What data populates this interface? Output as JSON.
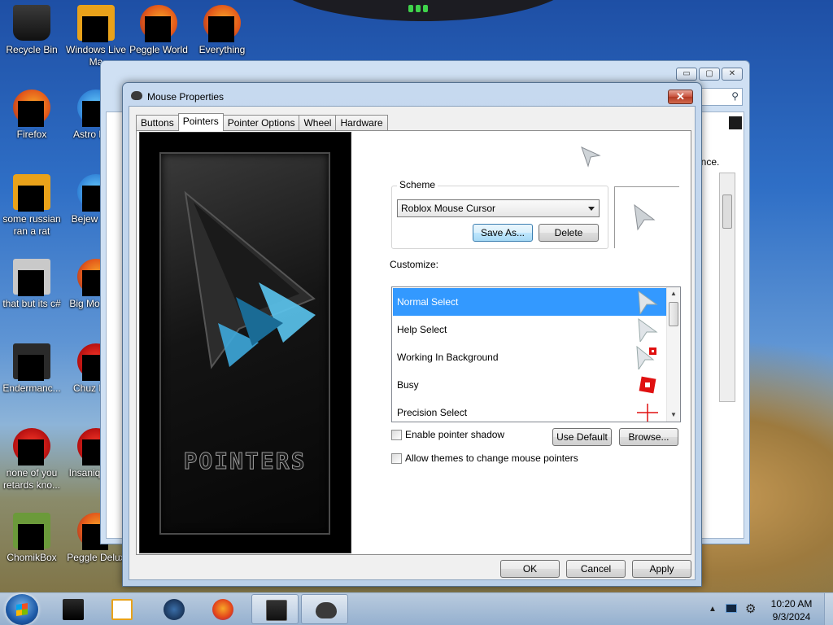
{
  "desktop": {
    "icons": [
      {
        "label": "Recycle Bin"
      },
      {
        "label": "Windows Live Ma"
      },
      {
        "label": "Peggle World"
      },
      {
        "label": "Everything"
      },
      {
        "label": "Firefox"
      },
      {
        "label": "Astro Delu"
      },
      {
        "label": "some russian ran a rat"
      },
      {
        "label": "Bejew Delu"
      },
      {
        "label": "that but its c#"
      },
      {
        "label": "Big Mo Delu"
      },
      {
        "label": "Endermanc..."
      },
      {
        "label": "Chuz Delu"
      },
      {
        "label": "none of you retards kno..."
      },
      {
        "label": "Insaniq Delu"
      },
      {
        "label": "ChomikBox"
      },
      {
        "label": "Peggle Delux"
      }
    ]
  },
  "background_window": {
    "controls": [
      "▭",
      "▢",
      "✕"
    ],
    "partial_text": "ence."
  },
  "dialog": {
    "title": "Mouse Properties",
    "close_label": "✕",
    "tabs": [
      {
        "label": "Buttons"
      },
      {
        "label": "Pointers",
        "active": true
      },
      {
        "label": "Pointer Options"
      },
      {
        "label": "Wheel"
      },
      {
        "label": "Hardware"
      }
    ],
    "art_title": "POINTERS",
    "scheme": {
      "label": "Scheme",
      "selected": "Roblox Mouse Cursor",
      "save_as": "Save As...",
      "delete": "Delete"
    },
    "customize": {
      "label": "Customize:",
      "rows": [
        {
          "label": "Normal Select",
          "icon": "arrow-cursor-icon",
          "selected": true
        },
        {
          "label": "Help Select",
          "icon": "help-cursor-icon"
        },
        {
          "label": "Working In Background",
          "icon": "working-cursor-icon"
        },
        {
          "label": "Busy",
          "icon": "busy-cursor-icon"
        },
        {
          "label": "Precision Select",
          "icon": "crosshair-cursor-icon"
        }
      ]
    },
    "enable_shadow": "Enable pointer shadow",
    "use_default": "Use Default",
    "browse": "Browse...",
    "allow_themes": "Allow themes to change mouse pointers",
    "ok": "OK",
    "cancel": "Cancel",
    "apply": "Apply"
  },
  "taskbar": {
    "time": "10:20 AM",
    "date": "9/3/2024",
    "tray_expand": "▲"
  }
}
